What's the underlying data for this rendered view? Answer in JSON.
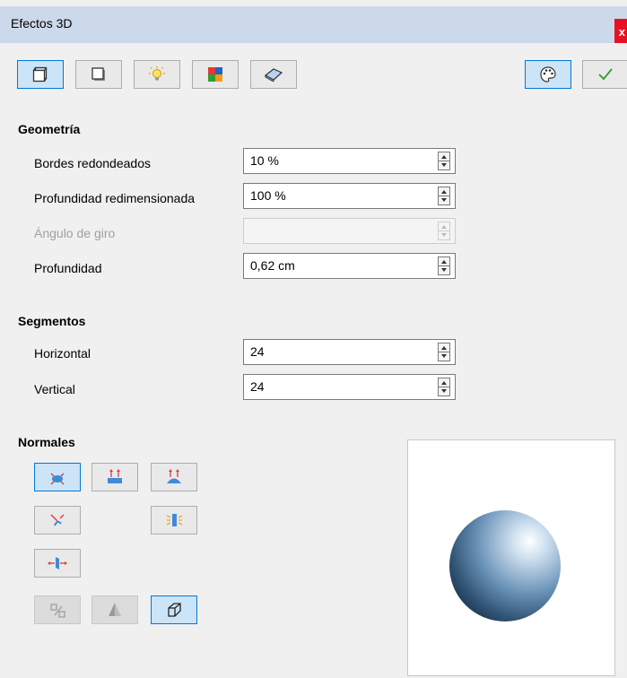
{
  "window": {
    "title": "Efectos 3D",
    "close_glyph": "x"
  },
  "toolbar": {
    "buttons": [
      {
        "name": "geometry-icon",
        "active": true
      },
      {
        "name": "shading-icon",
        "active": false
      },
      {
        "name": "illumination-icon",
        "active": false
      },
      {
        "name": "textures-icon",
        "active": false
      },
      {
        "name": "material-icon",
        "active": false
      }
    ],
    "right_buttons": [
      {
        "name": "palette-icon",
        "active": true
      },
      {
        "name": "checkmark-icon",
        "active": false
      }
    ]
  },
  "geometria": {
    "heading": "Geometría",
    "fields": [
      {
        "label": "Bordes redondeados",
        "value": "10 %",
        "disabled": false
      },
      {
        "label": "Profundidad redimensionada",
        "value": "100 %",
        "disabled": false
      },
      {
        "label": "Ángulo de giro",
        "value": "",
        "disabled": true
      },
      {
        "label": "Profundidad",
        "value": "0,62 cm",
        "disabled": false
      }
    ]
  },
  "segmentos": {
    "heading": "Segmentos",
    "fields": [
      {
        "label": "Horizontal",
        "value": "24"
      },
      {
        "label": "Vertical",
        "value": "24"
      }
    ]
  },
  "normales": {
    "heading": "Normales",
    "buttons": [
      {
        "name": "object-specific-normals-icon",
        "active": true
      },
      {
        "name": "flat-normals-icon",
        "active": false
      },
      {
        "name": "spherical-normals-icon",
        "active": false
      },
      {
        "name": "invert-normals-icon",
        "active": false
      },
      {
        "name": "double-sided-illumination-icon",
        "active": false
      },
      {
        "name": "double-sided-icon",
        "active": false
      },
      {
        "name": "convert-to-3d-icon",
        "disabled": true
      },
      {
        "name": "convert-to-lathe-icon",
        "disabled": true
      },
      {
        "name": "perspective-icon",
        "active": true
      }
    ]
  },
  "colors": {
    "titlebar": "#ccd9ea",
    "close": "#e81123",
    "active_fill": "#cce4f7",
    "active_border": "#0078d7",
    "check_green": "#2e9e32",
    "sphere": "#6a93b8"
  }
}
